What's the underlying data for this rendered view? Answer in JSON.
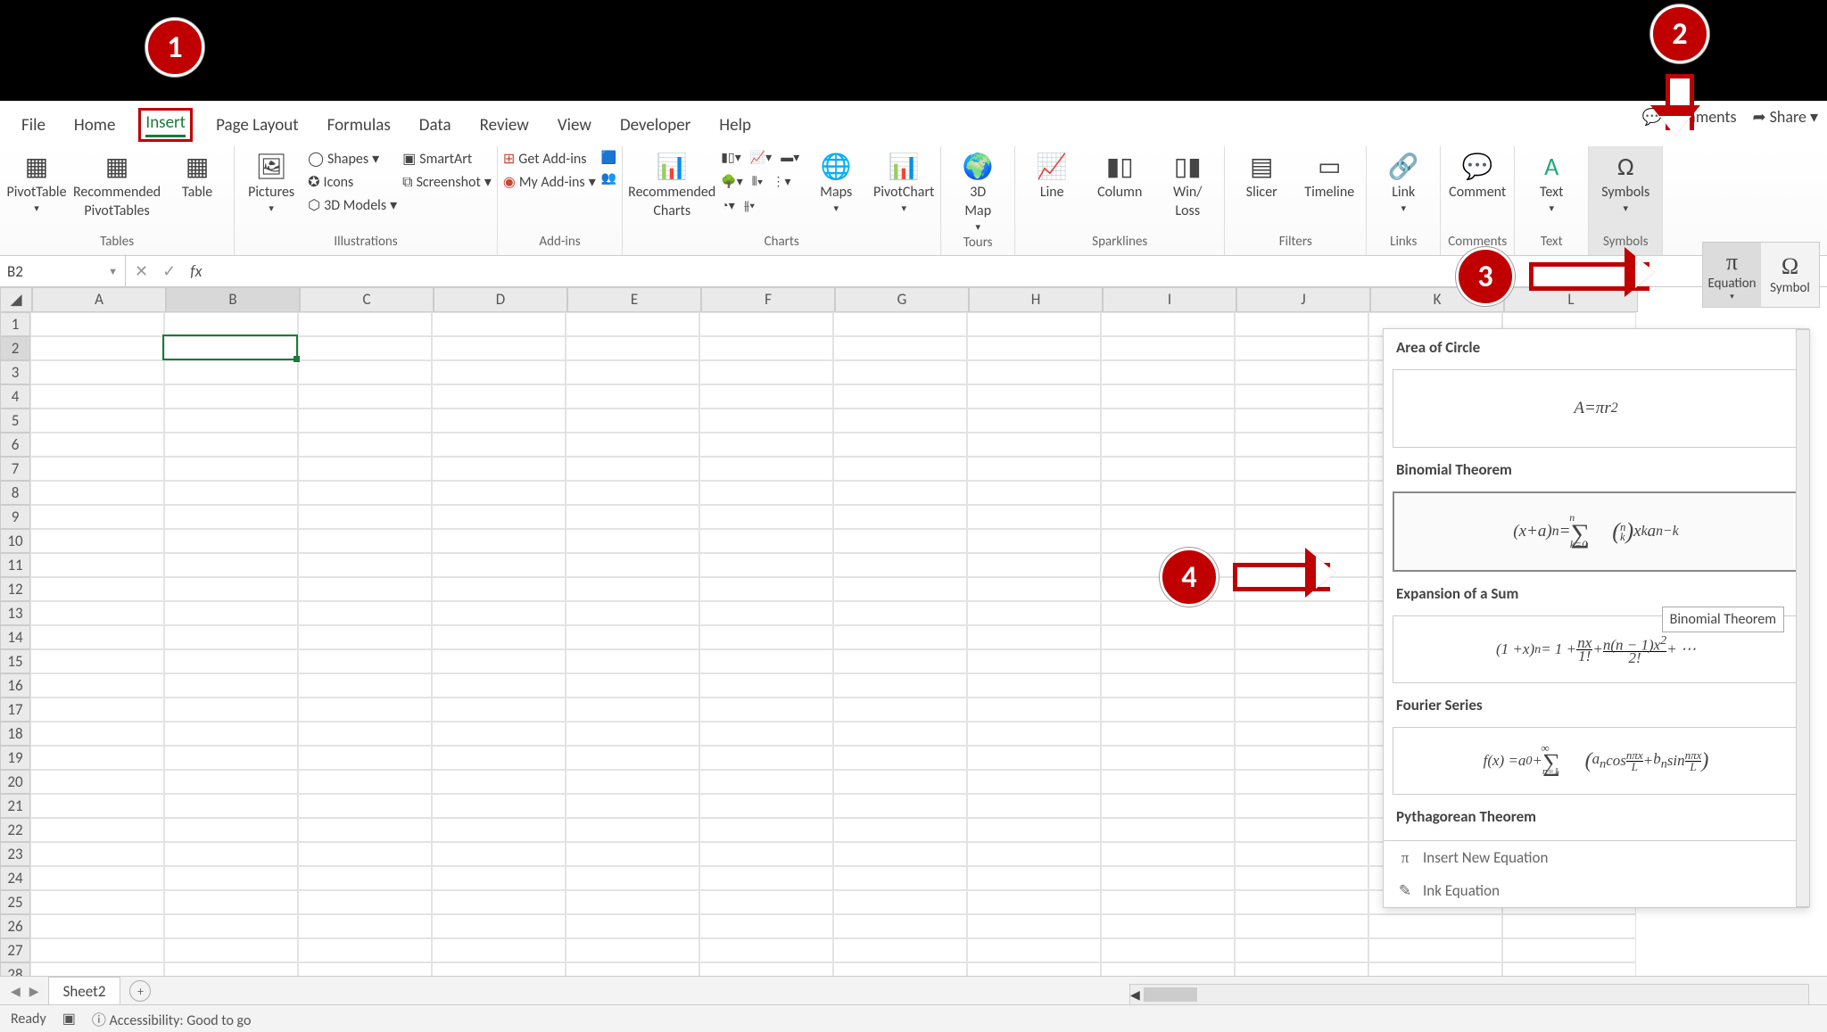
{
  "topright": {
    "comments": "Comments",
    "share": "Share"
  },
  "tabs": [
    "File",
    "Home",
    "Insert",
    "Page Layout",
    "Formulas",
    "Data",
    "Review",
    "View",
    "Developer",
    "Help"
  ],
  "active_tab_index": 2,
  "ribbon": {
    "tables": {
      "label": "Tables",
      "pivot": "PivotTable",
      "recpivot_l1": "Recommended",
      "recpivot_l2": "PivotTables",
      "table": "Table"
    },
    "illus": {
      "label": "Illustrations",
      "pictures": "Pictures",
      "shapes": "Shapes",
      "icons": "Icons",
      "models": "3D Models",
      "smartart": "SmartArt",
      "screenshot": "Screenshot"
    },
    "addins": {
      "label": "Add-ins",
      "get": "Get Add-ins",
      "my": "My Add-ins"
    },
    "charts": {
      "label": "Charts",
      "rec_l1": "Recommended",
      "rec_l2": "Charts",
      "maps": "Maps",
      "pivotchart": "PivotChart"
    },
    "tours": {
      "label": "Tours",
      "map_l1": "3D",
      "map_l2": "Map"
    },
    "spark": {
      "label": "Sparklines",
      "line": "Line",
      "column": "Column",
      "wl_l1": "Win/",
      "wl_l2": "Loss"
    },
    "filters": {
      "label": "Filters",
      "slicer": "Slicer",
      "timeline": "Timeline"
    },
    "links": {
      "label": "Links",
      "link": "Link"
    },
    "comments": {
      "label": "Comments",
      "comment": "Comment"
    },
    "text": {
      "label": "Text",
      "text": "Text"
    },
    "symbols": {
      "label": "Symbols",
      "symbols": "Symbols"
    }
  },
  "symbols_popup": {
    "equation": "Equation",
    "symbol": "Symbol"
  },
  "namebox": "B2",
  "columns": [
    "A",
    "B",
    "C",
    "D",
    "E",
    "F",
    "G",
    "H",
    "I",
    "J",
    "K",
    "L"
  ],
  "rows": 29,
  "selected_cell": "B2",
  "sheet_tab": "Sheet2",
  "dropdown": {
    "items": [
      {
        "title": "Area of Circle",
        "html": "<i>A</i> = <i>πr</i><sup>2</sup>"
      },
      {
        "title": "Binomial Theorem",
        "html": "(<i>x</i> + <i>a</i>)<sup><i>n</i></sup> = <span style='font-size:30px;position:relative;top:3px'>∑</span><sub style='position:relative;left:-22px;top:14px;font-size:12px'>k=0</sub><sup style='position:relative;left:-42px;top:-16px;font-size:12px'>n</sup><span style='font-size:26px'>(</span><span style='display:inline-block;line-height:11px;font-size:13px;vertical-align:middle'><i>n</i><br><i>k</i></span><span style='font-size:26px'>)</span> <i>x</i><sup><i>k</i></sup><i>a</i><sup><i>n−k</i></sup>",
        "selected": true
      },
      {
        "title": "Expansion of a Sum",
        "html": "(1 + <i>x</i>)<sup><i>n</i></sup> = 1 + <span style='display:inline-block;text-align:center;line-height:14px;vertical-align:middle'><i>nx</i><span style='display:block;border-top:1px solid #000;padding:0 2px'>1!</span></span> + <span style='display:inline-block;text-align:center;line-height:14px;vertical-align:middle'><i>n</i>(<i>n</i> − 1)<i>x</i><sup>2</sup><span style='display:block;border-top:1px solid #000;padding:0 2px'>2!</span></span> + ⋯"
      },
      {
        "title": "Fourier Series",
        "html": "<i>f</i>(<i>x</i>) = <i>a</i><sub>0</sub> + <span style='font-size:28px;position:relative;top:3px'>∑</span><sub style='position:relative;left:-20px;top:12px;font-size:11px'>n=1</sub><sup style='position:relative;left:-40px;top:-14px;font-size:13px'>∞</sup><span style='font-size:24px'>(</span><i>a<sub>n</sub></i> cos <span style='display:inline-block;text-align:center;line-height:12px;vertical-align:middle;font-size:13px'><i>nπx</i><span style='display:block;border-top:1px solid #000'>L</span></span> + <i>b<sub>n</sub></i> sin <span style='display:inline-block;text-align:center;line-height:12px;vertical-align:middle;font-size:13px'><i>nπx</i><span style='display:block;border-top:1px solid #000'>L</span></span><span style='font-size:24px'>)</span>"
      },
      {
        "title": "Pythagorean Theorem",
        "html": ""
      }
    ],
    "tooltip": "Binomial Theorem",
    "footer_insert": "Insert New Equation",
    "footer_ink": "Ink Equation"
  },
  "status": {
    "ready": "Ready",
    "access": "Accessibility: Good to go"
  },
  "annotations": {
    "a1": "1",
    "a2": "2",
    "a3": "3",
    "a4": "4"
  }
}
